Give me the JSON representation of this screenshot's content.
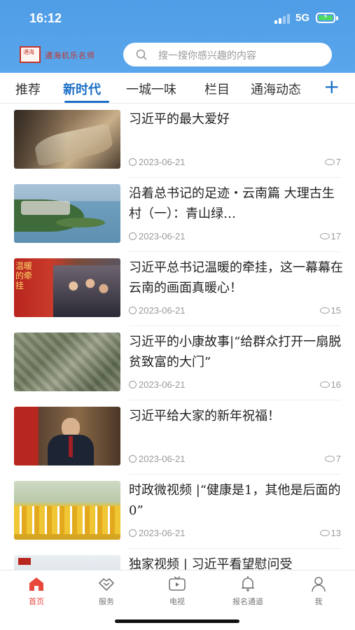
{
  "status_bar": {
    "time": "16:12",
    "network": "5G"
  },
  "header": {
    "brand_text": "通海机乐名师",
    "logo_text": "通海"
  },
  "search": {
    "placeholder": "搜一搜你感兴趣的内容"
  },
  "tabs": [
    {
      "label": "推荐",
      "active": false
    },
    {
      "label": "新时代",
      "active": true
    },
    {
      "label": "一城一味",
      "active": false
    },
    {
      "label": "栏目",
      "active": false
    },
    {
      "label": "通海动态",
      "active": false
    }
  ],
  "articles": [
    {
      "title": "习近平的最大爱好",
      "date": "2023-06-21",
      "views": "7",
      "thumb": "book"
    },
    {
      "title": "沿着总书记的足迹・云南篇 大理古生村（一）：青山绿…",
      "date": "2023-06-21",
      "views": "17",
      "thumb": "lake"
    },
    {
      "title": "习近平总书记温暖的牵挂，这一幕幕在云南的画面真暖心！",
      "date": "2023-06-21",
      "views": "15",
      "thumb": "crowd",
      "thumb_text": "温暖的牵挂"
    },
    {
      "title": "习近平的小康故事|“给群众打开一扇脱贫致富的大门”",
      "date": "2023-06-21",
      "views": "16",
      "thumb": "mountain"
    },
    {
      "title": "习近平给大家的新年祝福！",
      "date": "2023-06-21",
      "views": "7",
      "thumb": "speech"
    },
    {
      "title": "时政微视频 |“健康是1，其他是后面的0”",
      "date": "2023-06-21",
      "views": "13",
      "thumb": "dance"
    },
    {
      "title": "独家视频 | 习近平看望慰问受",
      "date": "",
      "views": "",
      "thumb": "snow"
    }
  ],
  "bottom_nav": [
    {
      "label": "首页",
      "icon": "home-icon",
      "active": true
    },
    {
      "label": "服务",
      "icon": "handshake-icon",
      "active": false
    },
    {
      "label": "电视",
      "icon": "tv-icon",
      "active": false
    },
    {
      "label": "报名通道",
      "icon": "bell-icon",
      "active": false
    },
    {
      "label": "我",
      "icon": "user-icon",
      "active": false
    }
  ],
  "colors": {
    "header": "#5aa6ec",
    "accent": "#1b6fc7",
    "nav_active": "#e8473c"
  }
}
